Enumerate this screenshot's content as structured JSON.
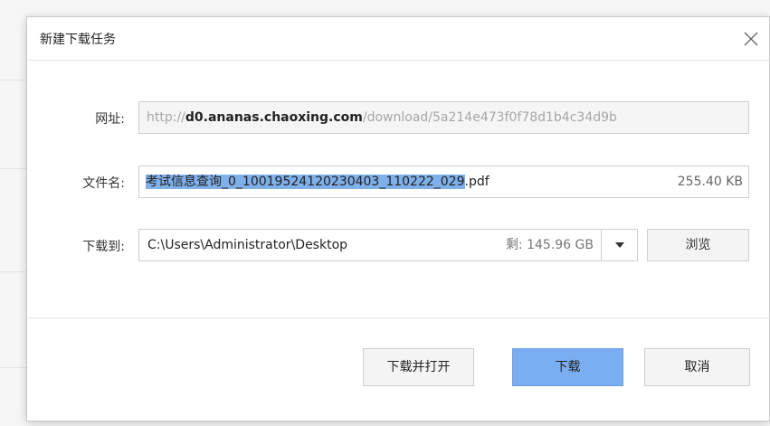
{
  "dialog": {
    "title": "新建下载任务"
  },
  "url_row": {
    "label": "网址:",
    "prefix": "http://",
    "host": "d0.ananas.chaoxing.com",
    "path": "/download/5a214e473f0f78d1b4c34d9b"
  },
  "name_row": {
    "label": "文件名:",
    "filename_selected": "考试信息查询_0_10019524120230403_110222_029",
    "extension": ".pdf",
    "size": "255.40 KB"
  },
  "dir_row": {
    "label": "下载到:",
    "path": "C:\\Users\\Administrator\\Desktop",
    "free_space": "剩: 145.96 GB",
    "browse_label": "浏览"
  },
  "buttons": {
    "download_open": "下载并打开",
    "download": "下载",
    "cancel": "取消"
  },
  "colors": {
    "primary_button": "#7aaef0",
    "selection": "#7fb0ea"
  }
}
